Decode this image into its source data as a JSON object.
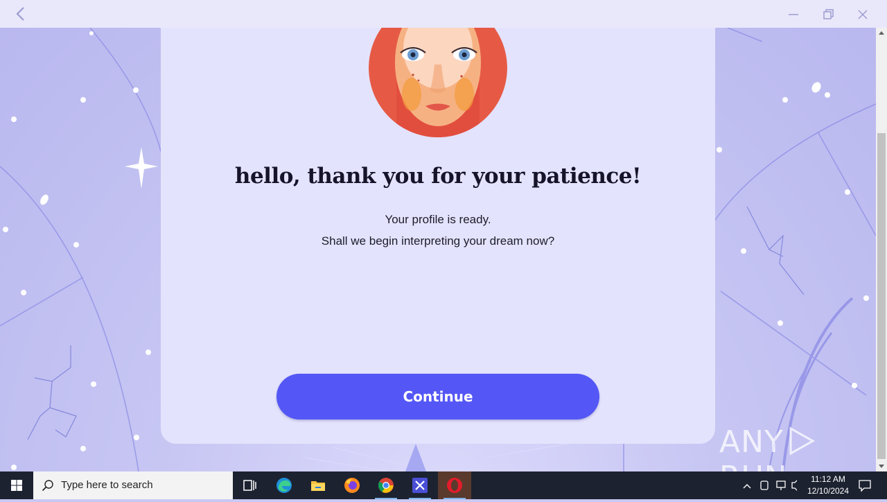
{
  "window": {
    "back_icon": "chevron-left-icon",
    "controls": [
      "minimize-icon",
      "restore-icon",
      "close-icon"
    ]
  },
  "card": {
    "heading": "hello, thank you for your patience!",
    "line1": "Your profile is ready.",
    "line2": "Shall we begin interpreting your dream now?",
    "continue_label": "Continue"
  },
  "watermark": {
    "left": "ANY",
    "right": "RUN"
  },
  "taskbar": {
    "search_placeholder": "Type here to search",
    "apps": [
      "task-view",
      "edge",
      "file-explorer",
      "firefox",
      "chrome",
      "app",
      "opera"
    ],
    "time": "11:12 AM",
    "date": "12/10/2024"
  },
  "colors": {
    "accent": "#5457f5",
    "card": "#e4e3fd",
    "background": "#c7c6f3"
  }
}
